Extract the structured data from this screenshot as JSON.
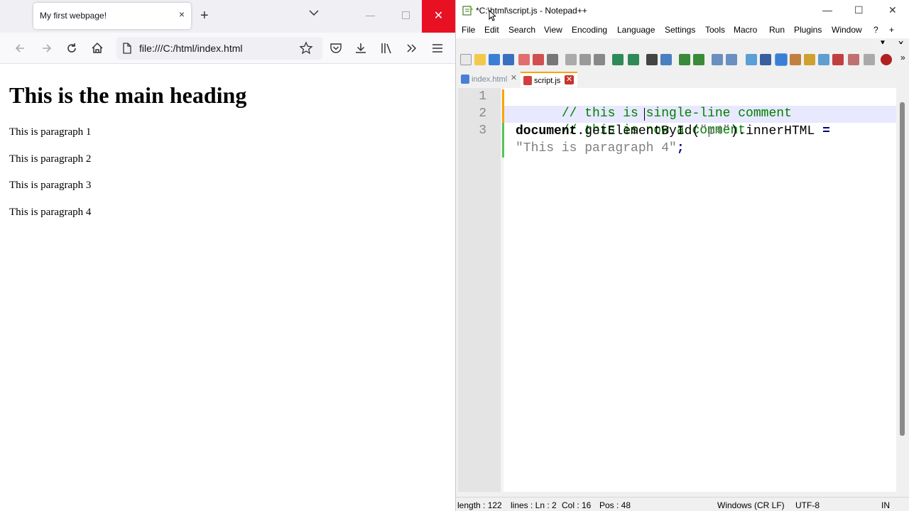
{
  "browser": {
    "tab_title": "My first webpage!",
    "tab_close": "×",
    "new_tab": "+",
    "window_close": "✕",
    "url": "file:///C:/html/index.html",
    "content": {
      "heading": "This is the main heading",
      "paragraphs": [
        "This is paragraph 1",
        "This is paragraph 2",
        "This is paragraph 3",
        "This is paragraph 4"
      ]
    }
  },
  "editor": {
    "title": "*C:\\html\\script.js - Notepad++",
    "menu": [
      "File",
      "Edit",
      "Search",
      "View",
      "Encoding",
      "Language",
      "Settings",
      "Tools",
      "Macro",
      "Run",
      "Plugins",
      "Window",
      "?"
    ],
    "menu_plus": "+",
    "menu_down": "▼",
    "menu_close": "✕",
    "tabs": [
      {
        "label": "index.html",
        "active": false
      },
      {
        "label": "script.js",
        "active": true
      }
    ],
    "tab_close": "✕",
    "line_numbers": [
      "1",
      "2",
      "3"
    ],
    "code": {
      "line1_comment": "// this is single-line comment",
      "line2_comment": "// this is now a comment",
      "line3_object": "document",
      "line3_method": ".getElementById(",
      "line3_arg": "\"p4\"",
      "line3_prop": ").innerHTML ",
      "line3_eq": "=",
      "line4_string": "\"This is paragraph 4\"",
      "line4_end": ";"
    },
    "status": {
      "length": "length : 122",
      "lines": "lines : Ln : 2",
      "col": "Col : 16",
      "pos": "Pos : 48",
      "eol": "Windows (CR LF)",
      "encoding": "UTF-8",
      "mode": "IN"
    },
    "window_controls": {
      "min": "—",
      "max": "☐",
      "close": "✕"
    }
  },
  "colors": {
    "close_red": "#e81123",
    "comment_green": "#008000",
    "tab_accent": "#f7a400",
    "current_line": "#e8e8ff"
  }
}
